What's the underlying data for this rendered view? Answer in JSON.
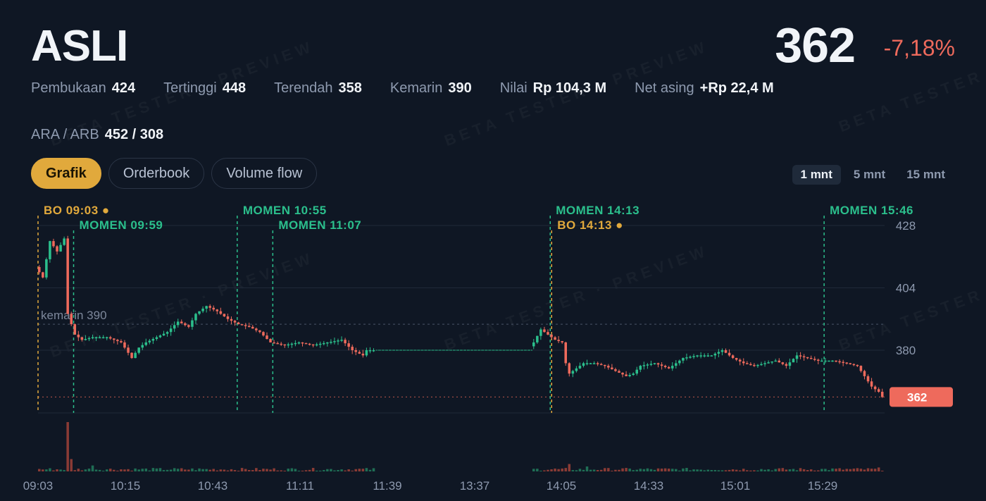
{
  "header": {
    "ticker": "ASLI",
    "price": "362",
    "change": "-7,18%"
  },
  "stats": [
    {
      "label": "Pembukaan",
      "value": "424"
    },
    {
      "label": "Tertinggi",
      "value": "448"
    },
    {
      "label": "Terendah",
      "value": "358"
    },
    {
      "label": "Kemarin",
      "value": "390"
    },
    {
      "label": "Nilai",
      "value": "Rp 104,3 M"
    },
    {
      "label": "Net asing",
      "value": "+Rp 22,4 M"
    }
  ],
  "ara_arb": {
    "label": "ARA / ARB",
    "value": "452 / 308"
  },
  "tabs": [
    {
      "label": "Grafik",
      "active": true
    },
    {
      "label": "Orderbook",
      "active": false
    },
    {
      "label": "Volume flow",
      "active": false
    }
  ],
  "timeframes": [
    {
      "label": "1 mnt",
      "active": true
    },
    {
      "label": "5 mnt",
      "active": false
    },
    {
      "label": "15 mnt",
      "active": false
    }
  ],
  "watermark": "BETA TESTER · PREVIEW",
  "colors": {
    "up": "#2bbf8c",
    "down": "#ee6a5c",
    "accent": "#e1a93c",
    "bg": "#0f1724"
  },
  "chart_data": {
    "type": "candlestick",
    "y_ticks": [
      428,
      404,
      380
    ],
    "ylim": [
      356,
      432
    ],
    "x_ticks": [
      "09:03",
      "10:15",
      "10:43",
      "11:11",
      "11:39",
      "13:37",
      "14:05",
      "14:33",
      "15:01",
      "15:29"
    ],
    "reference": {
      "label": "kemarin 390",
      "value": 390
    },
    "last_price": {
      "label": "362",
      "value": 362
    },
    "markers": [
      {
        "label": "BO 09:03 ●",
        "kind": "bo",
        "time": "09:03"
      },
      {
        "label": "MOMEN 09:59",
        "kind": "momen",
        "time": "09:59"
      },
      {
        "label": "MOMEN 10:55",
        "kind": "momen",
        "time": "10:55"
      },
      {
        "label": "MOMEN 11:07",
        "kind": "momen",
        "time": "11:07"
      },
      {
        "label": "MOMEN 14:13",
        "kind": "momen",
        "time": "14:13"
      },
      {
        "label": "BO 14:13 ●",
        "kind": "bo",
        "time": "14:13"
      },
      {
        "label": "MOMEN 15:46",
        "kind": "momen",
        "time": "15:46"
      }
    ],
    "price_path": [
      [
        0,
        412
      ],
      [
        2,
        408
      ],
      [
        4,
        422
      ],
      [
        6,
        418
      ],
      [
        8,
        423
      ],
      [
        9,
        394
      ],
      [
        11,
        386
      ],
      [
        13,
        384
      ],
      [
        16,
        385
      ],
      [
        20,
        385
      ],
      [
        24,
        383
      ],
      [
        27,
        377
      ],
      [
        29,
        381
      ],
      [
        31,
        383
      ],
      [
        34,
        385
      ],
      [
        37,
        387
      ],
      [
        40,
        391
      ],
      [
        43,
        389
      ],
      [
        45,
        394
      ],
      [
        48,
        397
      ],
      [
        51,
        395
      ],
      [
        54,
        392
      ],
      [
        57,
        390
      ],
      [
        60,
        389
      ],
      [
        63,
        387
      ],
      [
        66,
        383
      ],
      [
        70,
        382
      ],
      [
        74,
        383
      ],
      [
        78,
        382
      ],
      [
        82,
        383
      ],
      [
        86,
        384
      ],
      [
        89,
        380
      ],
      [
        92,
        378
      ],
      [
        93,
        380
      ],
      [
        95,
        380
      ],
      [
        115,
        380
      ],
      [
        138,
        380
      ],
      [
        140,
        383
      ],
      [
        142,
        388
      ],
      [
        144,
        386
      ],
      [
        146,
        384
      ],
      [
        148,
        383
      ],
      [
        149,
        375
      ],
      [
        150,
        371
      ],
      [
        152,
        373
      ],
      [
        154,
        375
      ],
      [
        157,
        375
      ],
      [
        160,
        374
      ],
      [
        163,
        372
      ],
      [
        166,
        370
      ],
      [
        168,
        371
      ],
      [
        170,
        374
      ],
      [
        174,
        375
      ],
      [
        178,
        373
      ],
      [
        182,
        377
      ],
      [
        186,
        378
      ],
      [
        190,
        378
      ],
      [
        193,
        380
      ],
      [
        196,
        377
      ],
      [
        199,
        375
      ],
      [
        202,
        374
      ],
      [
        205,
        375
      ],
      [
        208,
        376
      ],
      [
        211,
        374
      ],
      [
        214,
        378
      ],
      [
        217,
        377
      ],
      [
        220,
        376
      ],
      [
        224,
        376
      ],
      [
        228,
        375
      ],
      [
        231,
        374
      ],
      [
        233,
        370
      ],
      [
        235,
        366
      ],
      [
        237,
        364
      ],
      [
        238,
        362
      ]
    ],
    "volume_spikes": [
      [
        8,
        1.0
      ],
      [
        9,
        0.25
      ],
      [
        15,
        0.12
      ],
      [
        149,
        0.15
      ],
      [
        154,
        0.1
      ],
      [
        236,
        0.08
      ]
    ]
  }
}
